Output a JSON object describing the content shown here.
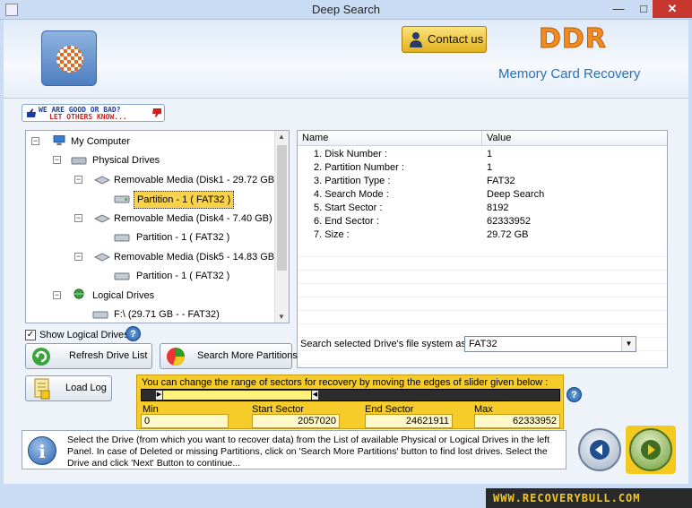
{
  "window": {
    "title": "Deep Search"
  },
  "header": {
    "contact_label": "Contact us",
    "brand": "DDR",
    "product": "Memory Card Recovery"
  },
  "rating": {
    "line1": "WE ARE GOOD OR BAD?",
    "line2": "LET OTHERS KNOW..."
  },
  "tree": {
    "root": "My Computer",
    "physical": "Physical Drives",
    "disk1": "Removable Media (Disk1 - 29.72 GB)",
    "disk1_part": "Partition - 1 ( FAT32 )",
    "disk4": "Removable Media (Disk4 - 7.40 GB)",
    "disk4_part": "Partition - 1 ( FAT32 )",
    "disk5": "Removable Media (Disk5 - 14.83 GB)",
    "disk5_part": "Partition - 1 ( FAT32 )",
    "logical": "Logical Drives",
    "logical_f": "F:\\ (29.71 GB -  - FAT32)"
  },
  "grid": {
    "col_name": "Name",
    "col_value": "Value",
    "rows": [
      {
        "name": "1. Disk Number :",
        "value": "1"
      },
      {
        "name": "2. Partition Number :",
        "value": "1"
      },
      {
        "name": "3. Partition Type :",
        "value": "FAT32"
      },
      {
        "name": "4. Search Mode :",
        "value": "Deep Search"
      },
      {
        "name": "5. Start Sector :",
        "value": "8192"
      },
      {
        "name": "6. End Sector :",
        "value": "62333952"
      },
      {
        "name": "7. Size :",
        "value": "29.72 GB"
      }
    ]
  },
  "controls": {
    "show_logical": "Show Logical Drives",
    "show_logical_checked": true,
    "refresh": "Refresh Drive List",
    "search_more": "Search More Partitions",
    "search_fs_label": "Search selected Drive's file system as:",
    "fs_value": "FAT32",
    "load_log": "Load Log"
  },
  "sectors": {
    "hint": "You can change the range of sectors for recovery by moving the edges of slider given below :",
    "min_label": "Min",
    "min_value": "0",
    "start_label": "Start Sector",
    "start_value": "2057020",
    "end_label": "End Sector",
    "end_value": "24621911",
    "max_label": "Max",
    "max_value": "62333952"
  },
  "info": {
    "text": "Select the Drive (from which you want to recover data) from the List of available Physical or Logical Drives in the left Panel. In case of Deleted or missing Partitions, click on 'Search More Partitions' button to find lost drives. Select the Drive and click 'Next' Button to continue..."
  },
  "footer": {
    "site": "WWW.RECOVERYBULL.COM"
  },
  "colors": {
    "accent": "#f5cc2a",
    "brand": "#f28b22",
    "product": "#2a6fb6"
  }
}
